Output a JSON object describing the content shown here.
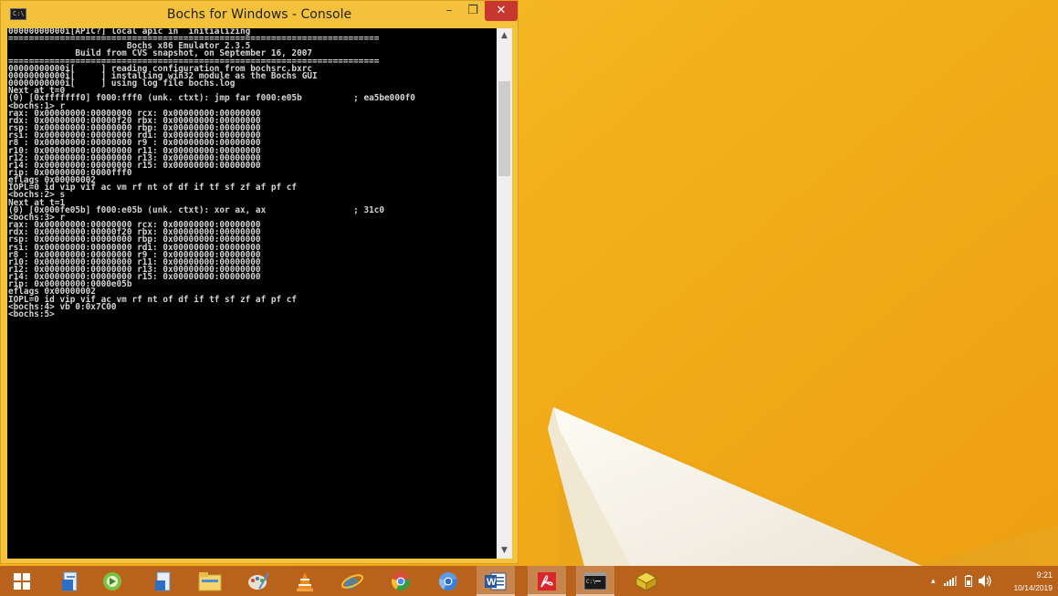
{
  "window": {
    "title": "Bochs for Windows - Console",
    "icon_glyph": "C:\\",
    "min_glyph": "–",
    "max_glyph": "❐",
    "close_glyph": "✕"
  },
  "terminal": {
    "lines": [
      "00000000000i[APIC?] local apic in  initializing",
      "========================================================================",
      "                       Bochs x86 Emulator 2.3.5",
      "             Build from CVS snapshot, on September 16, 2007",
      "========================================================================",
      "00000000000i[     ] reading configuration from bochsrc.bxrc",
      "00000000000i[     ] installing win32 module as the Bochs GUI",
      "00000000000i[     ] using log file bochs.log",
      "Next at t=0",
      "(0) [0xfffffff0] f000:fff0 (unk. ctxt): jmp far f000:e05b          ; ea5be000f0",
      "<bochs:1> r",
      "rax: 0x00000000:00000000 rcx: 0x00000000:00000000",
      "rdx: 0x00000000:00000f20 rbx: 0x00000000:00000000",
      "rsp: 0x00000000:00000000 rbp: 0x00000000:00000000",
      "rsi: 0x00000000:00000000 rdi: 0x00000000:00000000",
      "r8 : 0x00000000:00000000 r9 : 0x00000000:00000000",
      "r10: 0x00000000:00000000 r11: 0x00000000:00000000",
      "r12: 0x00000000:00000000 r13: 0x00000000:00000000",
      "r14: 0x00000000:00000000 r15: 0x00000000:00000000",
      "rip: 0x00000000:0000fff0",
      "eflags 0x00000002",
      "IOPL=0 id vip vif ac vm rf nt of df if tf sf zf af pf cf",
      "<bochs:2> s",
      "Next at t=1",
      "(0) [0x000fe05b] f000:e05b (unk. ctxt): xor ax, ax                 ; 31c0",
      "<bochs:3> r",
      "rax: 0x00000000:00000000 rcx: 0x00000000:00000000",
      "rdx: 0x00000000:00000f20 rbx: 0x00000000:00000000",
      "rsp: 0x00000000:00000000 rbp: 0x00000000:00000000",
      "rsi: 0x00000000:00000000 rdi: 0x00000000:00000000",
      "r8 : 0x00000000:00000000 r9 : 0x00000000:00000000",
      "r10: 0x00000000:00000000 r11: 0x00000000:00000000",
      "r12: 0x00000000:00000000 r13: 0x00000000:00000000",
      "r14: 0x00000000:00000000 r15: 0x00000000:00000000",
      "rip: 0x00000000:0000e05b",
      "eflags 0x00000002",
      "IOPL=0 id vip vif ac vm rf nt of df if tf sf zf af pf cf",
      "<bochs:4> vb 0:0x7C00",
      "<bochs:5>"
    ]
  },
  "scrollbar": {
    "up_glyph": "▲",
    "down_glyph": "▼"
  },
  "taskbar": {
    "items": [
      {
        "name": "start-button-icon",
        "active": false
      },
      {
        "name": "file-explorer-icon",
        "active": false
      },
      {
        "name": "app-icon",
        "active": false
      },
      {
        "name": "document-icon",
        "active": false
      },
      {
        "name": "file-manager-icon",
        "active": false
      },
      {
        "name": "paint-icon",
        "active": false
      },
      {
        "name": "vlc-icon",
        "active": false
      },
      {
        "name": "internet-explorer-icon",
        "active": false
      },
      {
        "name": "chrome-icon",
        "active": false
      },
      {
        "name": "chrome-alt-icon",
        "active": false
      },
      {
        "name": "word-icon",
        "active": true
      },
      {
        "name": "acrobat-icon",
        "active": true
      },
      {
        "name": "command-prompt-icon",
        "active": true
      },
      {
        "name": "bochs-icon",
        "active": false
      }
    ],
    "word_letter": "W",
    "cmd_glyph": "C:\\"
  },
  "tray": {
    "time": "9:21",
    "date": "10/14/2019",
    "up_arrow": "▴"
  },
  "colors": {
    "taskbar": "#b9621c",
    "wallpaper": "#f2b01c",
    "close_button": "#c7372f"
  }
}
